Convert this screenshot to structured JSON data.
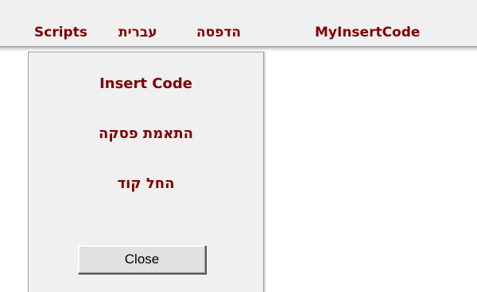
{
  "menubar": {
    "items": [
      {
        "id": "scripts",
        "label": "Scripts"
      },
      {
        "id": "hebrew",
        "label": "עברית"
      },
      {
        "id": "print",
        "label": "הדפסה"
      },
      {
        "id": "myinsertcode",
        "label": "MyInsertCode"
      }
    ]
  },
  "dropdown": {
    "items": [
      {
        "id": "insert-code",
        "label": "Insert Code"
      },
      {
        "id": "paragraph-fit",
        "label": "התאמת פסקה"
      },
      {
        "id": "start-code",
        "label": "החל קוד"
      }
    ],
    "close_label": "Close"
  },
  "colors": {
    "menu_text": "#800000",
    "menubar_bg": "#f0f0f0",
    "button_bg": "#e1e1e1"
  }
}
